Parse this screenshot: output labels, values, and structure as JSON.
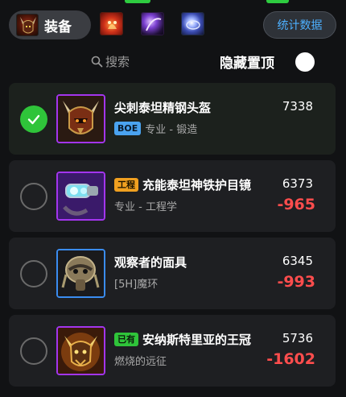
{
  "header": {
    "category_label": "装备",
    "category_icon": "horned-helmet-icon",
    "filters": [
      {
        "icon": "fiery-demon-icon",
        "accent": "#d0321a"
      },
      {
        "icon": "void-orb-icon",
        "accent": "#7a3fd0"
      },
      {
        "icon": "arcane-pearl-icon",
        "accent": "#9db2ff"
      }
    ],
    "stats_label": "统计数据"
  },
  "search": {
    "placeholder": "搜索"
  },
  "pin_toggle": {
    "label": "隐藏置顶",
    "on": false
  },
  "colors": {
    "epic_border": "#a335ee",
    "rare_border": "#3a8cf0",
    "negative": "#ff4d4d",
    "check_green": "#2fc43a",
    "link_blue": "#4db0ff"
  },
  "items": [
    {
      "name": "尖刺泰坦精钢头盔",
      "badge": "BOE",
      "badge_color": "blue",
      "badge_position": "subtitle",
      "subtitle": "专业 - 锻造",
      "price": "7338",
      "delta": "",
      "selected": true,
      "quality": "epic",
      "icon": "spiked-titan-helmet-icon"
    },
    {
      "name": "充能泰坦神铁护目镜",
      "badge": "工程",
      "badge_color": "orange",
      "badge_position": "name",
      "subtitle": "专业 - 工程学",
      "price": "6373",
      "delta": "-965",
      "selected": false,
      "quality": "epic",
      "icon": "goggles-icon"
    },
    {
      "name": "观察者的面具",
      "badge": "",
      "badge_color": "",
      "badge_position": "",
      "subtitle": "[5H]魔环",
      "price": "6345",
      "delta": "-993",
      "selected": false,
      "quality": "rare",
      "icon": "observer-mask-icon"
    },
    {
      "name": "安纳斯特里亚的王冠",
      "badge": "已有",
      "badge_color": "green",
      "badge_position": "name",
      "subtitle": "燃烧的远征",
      "price": "5736",
      "delta": "-1602",
      "selected": false,
      "quality": "epic",
      "icon": "demon-crown-icon"
    }
  ]
}
